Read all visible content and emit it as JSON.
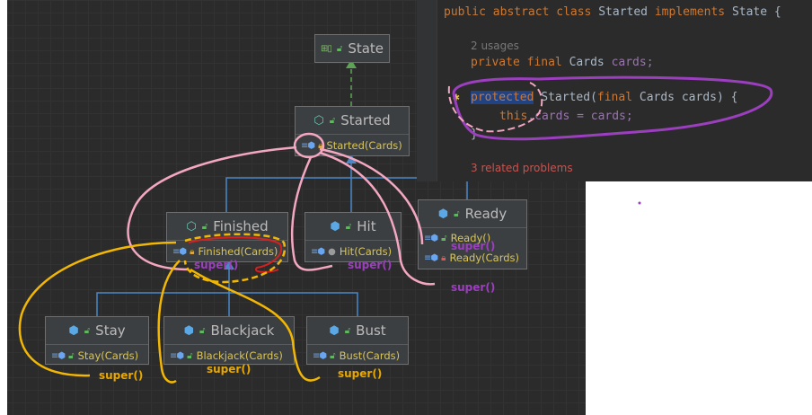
{
  "nodes": {
    "state": {
      "title": "State"
    },
    "started": {
      "title": "Started",
      "ctor": "Started(Cards)"
    },
    "finished": {
      "title": "Finished",
      "ctor": "Finished(Cards)"
    },
    "hit": {
      "title": "Hit",
      "ctor": "Hit(Cards)"
    },
    "ready": {
      "title": "Ready",
      "ctor1": "Ready()",
      "ctor2": "Ready(Cards)"
    },
    "stay": {
      "title": "Stay",
      "ctor": "Stay(Cards)"
    },
    "blackjack": {
      "title": "Blackjack",
      "ctor": "Blackjack(Cards)"
    },
    "bust": {
      "title": "Bust",
      "ctor": "Bust(Cards)"
    }
  },
  "annotations": {
    "super": "super()"
  },
  "code": {
    "line1_public": "public",
    "line1_abstract": "abstract",
    "line1_class": "class",
    "line1_name": "Started",
    "line1_implements": "implements",
    "line1_iface": "State {",
    "usages": "2 usages",
    "line2_private": "private",
    "line2_final": "final",
    "line2_type": "Cards",
    "line2_field": "cards;",
    "line3_protected": "protected",
    "line3_sig": "Started(",
    "line3_final": "final",
    "line3_params": "Cards cards) {",
    "line4_this": "this",
    "line4_rest": ".cards = cards;",
    "line5": "}",
    "problems": "3 related problems"
  },
  "colors": {
    "annotation_pink": "#f4a7c0",
    "annotation_yellow": "#f2b705",
    "annotation_purple": "#9b3fbf",
    "annotation_red": "#d62020"
  }
}
